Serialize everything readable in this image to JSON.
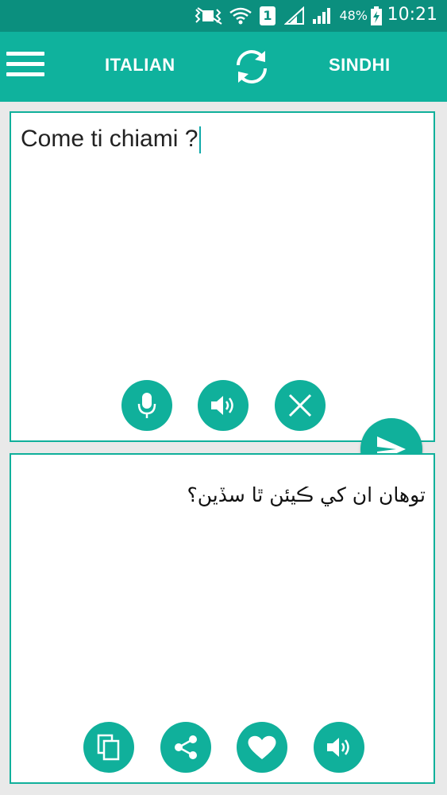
{
  "status_bar": {
    "time": "10:21",
    "battery": "48%",
    "sim_slot": "1"
  },
  "app_bar": {
    "source_language": "ITALIAN",
    "target_language": "SINDHI"
  },
  "input_panel": {
    "text": "Come ti chiami ?"
  },
  "output_panel": {
    "text": "توهان ان کي ڪيئن ٿا سڏين؟"
  },
  "colors": {
    "status_bar": "#0b8f7e",
    "app_bar": "#0fb29d",
    "accent": "#10b09b",
    "background": "#e9e9e9"
  },
  "icons": {
    "input_actions": [
      "microphone-icon",
      "speaker-icon",
      "clear-icon"
    ],
    "send": "send-icon",
    "output_actions": [
      "copy-icon",
      "share-icon",
      "heart-icon",
      "speaker-icon"
    ]
  }
}
